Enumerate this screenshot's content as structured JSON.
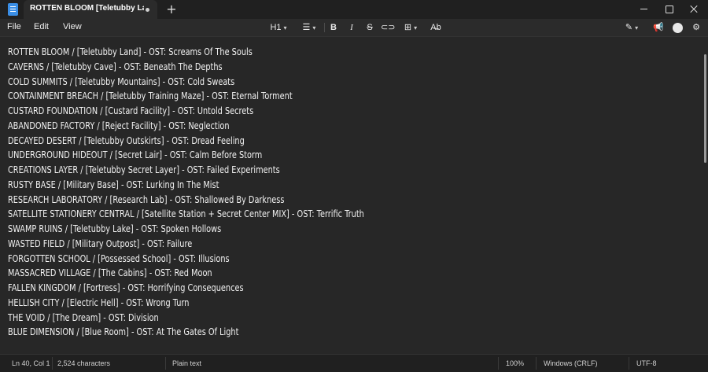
{
  "window": {
    "tab_title": "ROTTEN BLOOM  [Teletubby Land]·",
    "new_tab": "+"
  },
  "menu": {
    "file": "File",
    "edit": "Edit",
    "view": "View"
  },
  "toolbar": {
    "heading": "H1",
    "list_icon": "list-icon",
    "bold": "B",
    "italic": "I",
    "strike": "S",
    "link_icon": "link-icon",
    "table_icon": "table-icon",
    "spell_icon": "spellcheck-icon",
    "copilot_icon": "copilot-icon",
    "notify_icon": "megaphone-icon",
    "account_icon": "account-icon",
    "settings_icon": "gear-icon"
  },
  "content": {
    "lines": [
      "ROTTEN BLOOM / [Teletubby Land] - OST: Screams Of The Souls",
      "CAVERNS / [Teletubby Cave] - OST: Beneath The Depths",
      "COLD SUMMITS / [Teletubby Mountains] - OST: Cold Sweats",
      "CONTAINMENT BREACH / [Teletubby Training Maze] - OST: Eternal Torment",
      "CUSTARD FOUNDATION / [Custard Facility] - OST: Untold Secrets",
      "ABANDONED FACTORY / [Reject Facility] - OST: Neglection",
      "DECAYED DESERT / [Teletubby Outskirts] - OST: Dread Feeling",
      "UNDERGROUND HIDEOUT / [Secret Lair] - OST: Calm Before Storm",
      "CREATIONS LAYER / [Teletubby Secret Layer] - OST: Failed Experiments",
      "RUSTY BASE / [Military Base] - OST: Lurking In The Mist",
      "RESEARCH LABORATORY / [Research Lab] - OST: Shallowed By Darkness",
      "SATELLITE STATIONERY CENTRAL / [Satellite Station + Secret Center MIX] - OST: Terrific Truth",
      "SWAMP RUINS / [Teletubby Lake] - OST: Spoken Hollows",
      "WASTED FIELD / [Military Outpost] - OST: Failure",
      "FORGOTTEN SCHOOL / [Possessed School] - OST: Illusions",
      "MASSACRED VILLAGE / [The Cabins] - OST: Red Moon",
      "FALLEN KINGDOM / [Fortress] - OST: Horrifying Consequences",
      "HELLISH CITY / [Electric Hell] - OST: Wrong Turn",
      "THE VOID / [The Dream] - OST: Division",
      "BLUE DIMENSION / [Blue Room] - OST: At The Gates Of Light"
    ]
  },
  "status": {
    "position": "Ln 40, Col 1",
    "chars": "2,524 characters",
    "mode": "Plain text",
    "zoom": "100%",
    "line_ending": "Windows (CRLF)",
    "encoding": "UTF-8"
  }
}
